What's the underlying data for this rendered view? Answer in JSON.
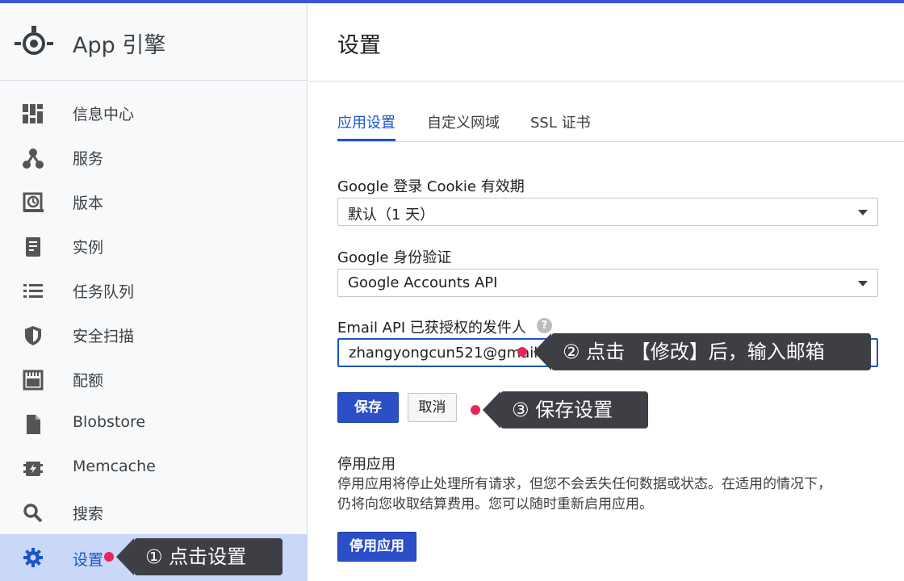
{
  "app": {
    "title": "App 引擎",
    "accent": "#3b55d9",
    "active_color": "#1a56c8"
  },
  "sidebar": {
    "items": [
      {
        "label": "信息中心",
        "icon": "dashboard-icon"
      },
      {
        "label": "服务",
        "icon": "services-icon"
      },
      {
        "label": "版本",
        "icon": "versions-icon"
      },
      {
        "label": "实例",
        "icon": "instances-icon"
      },
      {
        "label": "任务队列",
        "icon": "task-queue-icon"
      },
      {
        "label": "安全扫描",
        "icon": "security-shield-icon"
      },
      {
        "label": "配额",
        "icon": "quota-icon"
      },
      {
        "label": "Blobstore",
        "icon": "file-icon"
      },
      {
        "label": "Memcache",
        "icon": "memcache-icon"
      },
      {
        "label": "搜索",
        "icon": "search-icon"
      },
      {
        "label": "设置",
        "icon": "gear-icon",
        "active": true
      }
    ]
  },
  "main": {
    "title": "设置",
    "tabs": [
      {
        "label": "应用设置",
        "active": true
      },
      {
        "label": "自定义网域"
      },
      {
        "label": "SSL 证书"
      }
    ],
    "cookie": {
      "label": "Google 登录 Cookie 有效期",
      "value": "默认（1 天）"
    },
    "auth": {
      "label": "Google 身份验证",
      "value": "Google Accounts API"
    },
    "email": {
      "label": "Email API 已获授权的发件人",
      "help": "?",
      "value": "zhangyongcun521@gmail.com"
    },
    "buttons": {
      "save": "保存",
      "cancel": "取消"
    },
    "disable": {
      "title": "停用应用",
      "desc_line1": "停用应用将停止处理所有请求，但您不会丢失任何数据或状态。在适用的情况下，",
      "desc_line2": "仍将向您收取结算费用。您可以随时重新启用应用。",
      "button": "停用应用"
    }
  },
  "annotations": {
    "step1": "① 点击设置",
    "step2": "② 点击 【修改】后，输入邮箱",
    "step3": "③ 保存设置",
    "dot_color": "#e8245c"
  }
}
